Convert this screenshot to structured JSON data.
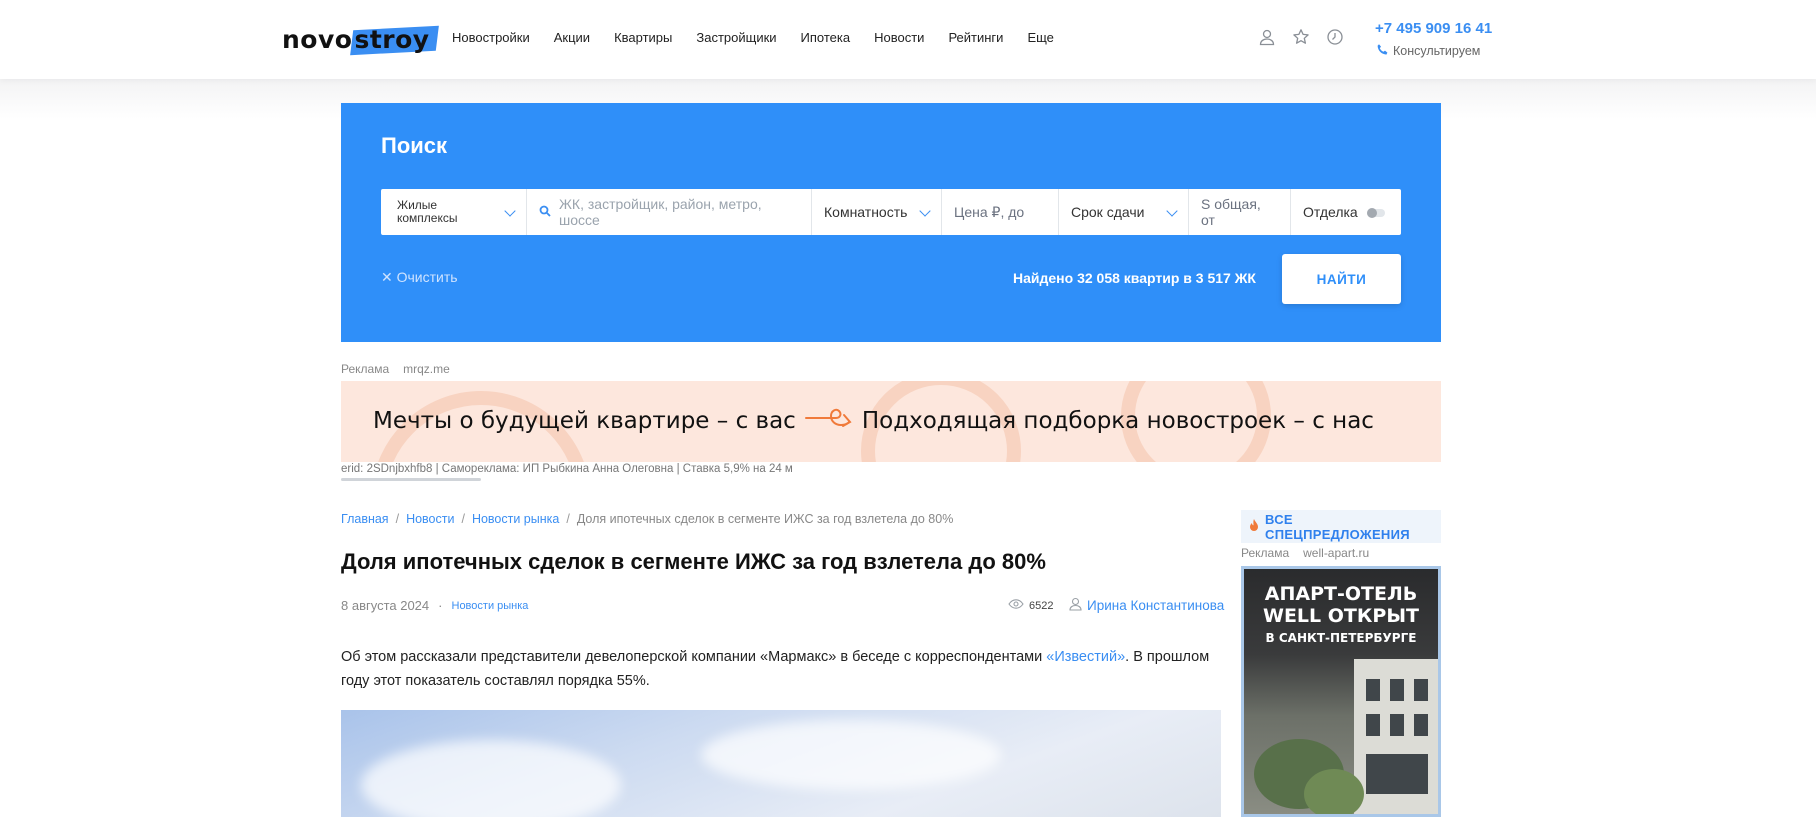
{
  "header": {
    "logo": {
      "part1": "novo",
      "part2": "stroy"
    },
    "nav": [
      "Новостройки",
      "Акции",
      "Квартиры",
      "Застройщики",
      "Ипотека",
      "Новости",
      "Рейтинги",
      "Еще"
    ],
    "icons": [
      "user-icon",
      "star-icon",
      "history-icon"
    ],
    "phone": "+7 495 909 16 41",
    "consult": "Консультируем"
  },
  "search": {
    "title": "Поиск",
    "type_value": "Жилые комплексы",
    "query_placeholder": "ЖК, застройщик, район, метро, шоссе",
    "rooms": "Комнатность",
    "price_placeholder": "Цена ₽, до",
    "deadline": "Срок сдачи",
    "area_placeholder": "S общая, от",
    "finish": "Отделка",
    "finish_toggle": false,
    "clear": "Очистить",
    "found": "Найдено 32 058 квартир в 3 517 ЖК",
    "submit": "НАЙТИ"
  },
  "ad_top": {
    "label": "Реклама",
    "domain": "mrqz.me",
    "text_left": "Мечты о будущей квартире – с вас",
    "text_right": "Подходящая подборка новостроек – с нас",
    "erid": "erid: 2SDnjbxhfb8 | Самореклама: ИП Рыбкина Анна Олеговна | Ставка 5,9% на 24 м"
  },
  "breadcrumbs": [
    "Главная",
    "Новости",
    "Новости рынка",
    "Доля ипотечных сделок в сегменте ИЖС за год взлетела до 80%"
  ],
  "article": {
    "title": "Доля ипотечных сделок в сегменте ИЖС за год взлетела до 80%",
    "date": "8 августа 2024",
    "category": "Новости рынка",
    "views": "6522",
    "author": "Ирина Константинова",
    "lead_before": "Об этом рассказали представители девелоперской компании «Мармакс» в беседе с корреспондентами ",
    "lead_link": "«Известий»",
    "lead_after": ". В прошлом году этот показатель составлял порядка 55%."
  },
  "sidebar": {
    "special": "ВСЕ СПЕЦПРЕДЛОЖЕНИЯ",
    "ad_label": "Реклама",
    "ad_domain": "well-apart.ru",
    "banner_line1": "АПАРТ-ОТЕЛЬ",
    "banner_line2": "WELL ОТКРЫТ",
    "banner_line3": "В САНКТ-ПЕТЕРБУРГЕ"
  },
  "colors": {
    "accent": "#2f8ff9",
    "link": "#3a8ef2",
    "fire": "#f07a3a"
  }
}
